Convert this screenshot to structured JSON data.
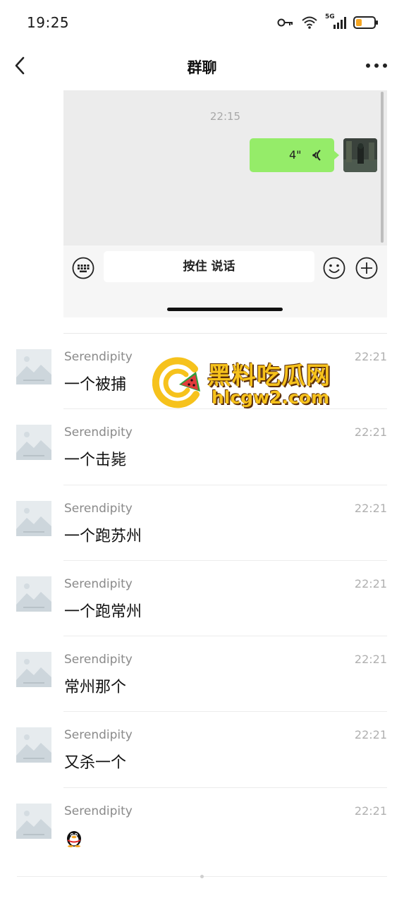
{
  "status_bar": {
    "time": "19:25",
    "network": "5G",
    "icons": [
      "key-icon",
      "wifi-icon",
      "signal-icon",
      "battery-icon"
    ]
  },
  "nav": {
    "title": "群聊",
    "back_icon": "chevron-left-icon",
    "more_icon": "more-icon"
  },
  "embedded_chat": {
    "timestamp": "22:15",
    "voice_message": {
      "duration": "4\"",
      "icon": "voice-wave-icon"
    },
    "input_bar": {
      "hold_to_talk": "按住 说话",
      "keyboard_icon": "keyboard-icon",
      "emoji_icon": "emoji-icon",
      "plus_icon": "plus-icon"
    }
  },
  "messages": [
    {
      "sender": "Serendipity",
      "time": "22:21",
      "text": "一个被捕"
    },
    {
      "sender": "Serendipity",
      "time": "22:21",
      "text": "一个击毙"
    },
    {
      "sender": "Serendipity",
      "time": "22:21",
      "text": "一个跑苏州"
    },
    {
      "sender": "Serendipity",
      "time": "22:21",
      "text": "一个跑常州"
    },
    {
      "sender": "Serendipity",
      "time": "22:21",
      "text": "常州那个"
    },
    {
      "sender": "Serendipity",
      "time": "22:21",
      "text": "又杀一个"
    },
    {
      "sender": "Serendipity",
      "time": "22:21",
      "text": "",
      "emoji": "qq-penguin-icon"
    }
  ],
  "watermark": {
    "title": "黑料吃瓜网",
    "domain": "hlcgw2.com"
  },
  "colors": {
    "voice_bubble": "#95ec69",
    "embed_bg": "#ececec",
    "watermark_gold": "#f6c21c"
  }
}
